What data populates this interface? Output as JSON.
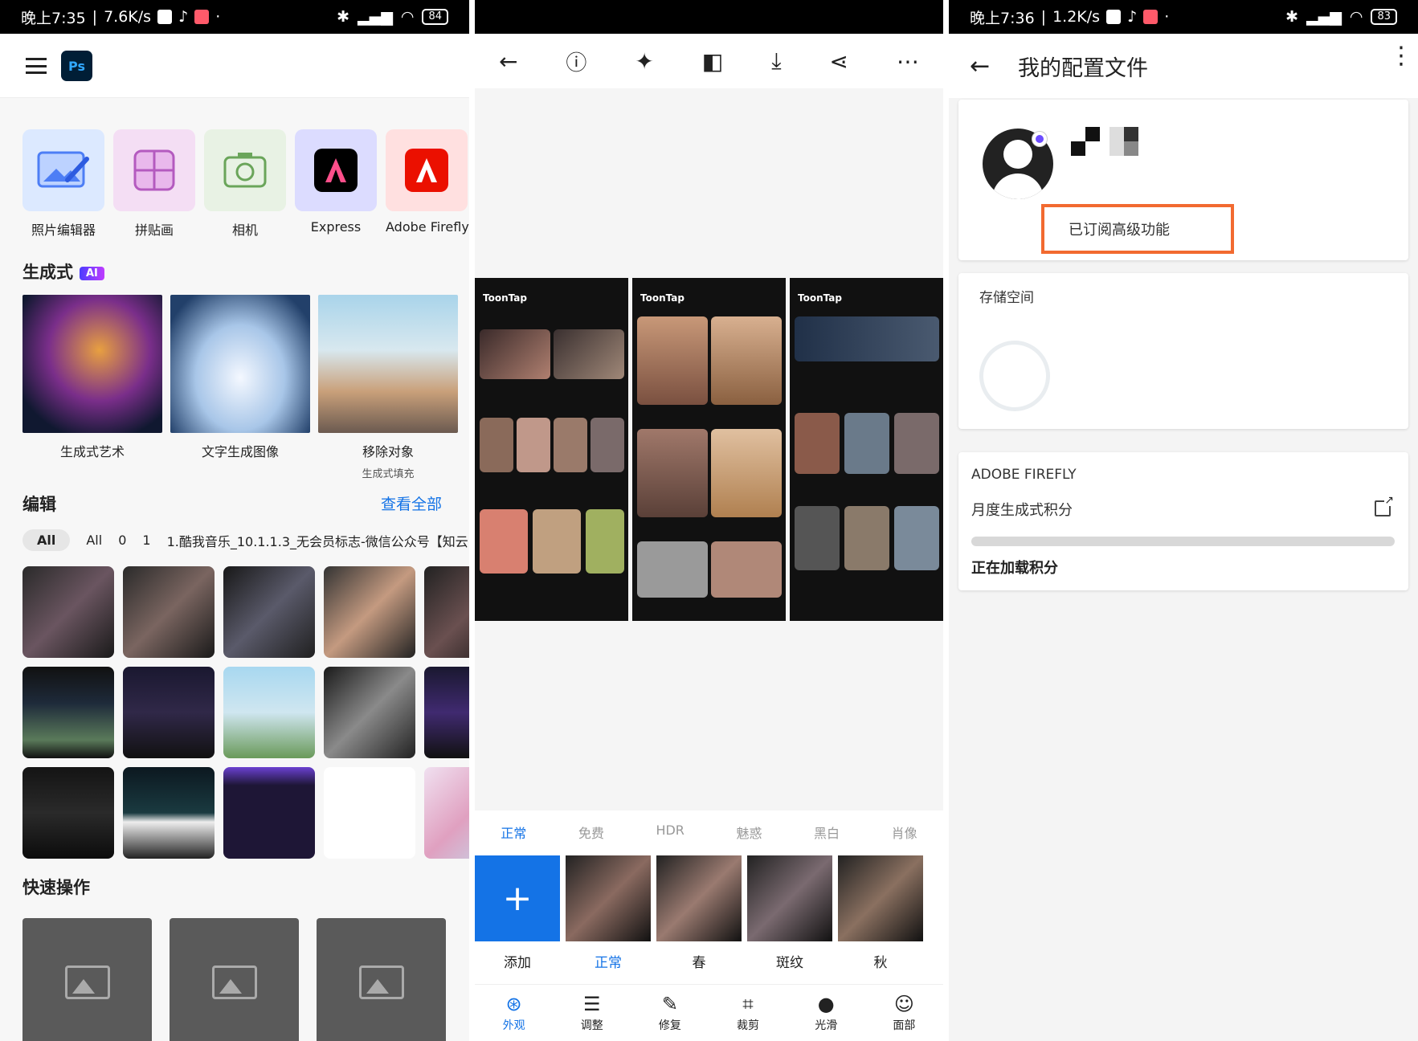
{
  "panel1": {
    "status": {
      "time": "晚上7:35",
      "speed": "7.6K/s",
      "battery": "84"
    },
    "logo": "Ps",
    "apps": [
      {
        "label": "照片编辑器",
        "icon": "photo-editor-icon",
        "color": "#dce9ff"
      },
      {
        "label": "拼贴画",
        "icon": "collage-icon",
        "color": "#f4def4"
      },
      {
        "label": "相机",
        "icon": "camera-icon",
        "color": "#e8f2e4"
      },
      {
        "label": "Express",
        "icon": "express-icon",
        "color": "#dcdcff"
      },
      {
        "label": "Adobe Firefly",
        "icon": "firefly-icon",
        "color": "#ffe0e0"
      }
    ],
    "generative": {
      "title": "生成式",
      "badge": "AI",
      "cards": [
        {
          "label": "生成式艺术",
          "sub": ""
        },
        {
          "label": "文字生成图像",
          "sub": ""
        },
        {
          "label": "移除对象",
          "sub": "生成式填充"
        }
      ]
    },
    "edit": {
      "title": "编辑",
      "see_all": "查看全部",
      "filters": [
        "All",
        "All",
        "0",
        "1",
        "1.酷我音乐_10.1.1.3_无会员标志-微信公众号【知云"
      ]
    },
    "quick": {
      "title": "快速操作"
    }
  },
  "panel2": {
    "shot_brand": "ToonTap",
    "fx_tabs": [
      "正常",
      "免费",
      "HDR",
      "魅惑",
      "黑白",
      "肖像"
    ],
    "presets": [
      "添加",
      "正常",
      "春",
      "斑纹",
      "秋"
    ],
    "add_symbol": "+",
    "nav": [
      {
        "label": "外观",
        "icon": "looks-icon"
      },
      {
        "label": "调整",
        "icon": "adjust-icon"
      },
      {
        "label": "修复",
        "icon": "heal-icon"
      },
      {
        "label": "裁剪",
        "icon": "crop-icon"
      },
      {
        "label": "光滑",
        "icon": "smooth-icon"
      },
      {
        "label": "面部",
        "icon": "face-icon"
      }
    ]
  },
  "panel3": {
    "status": {
      "time": "晚上7:36",
      "speed": "1.2K/s",
      "battery": "83"
    },
    "title": "我的配置文件",
    "subscribed": "已订阅高级功能",
    "storage": "存储空间",
    "firefly": {
      "title": "ADOBE FIREFLY",
      "credits": "月度生成式积分",
      "loading": "正在加载积分"
    }
  }
}
